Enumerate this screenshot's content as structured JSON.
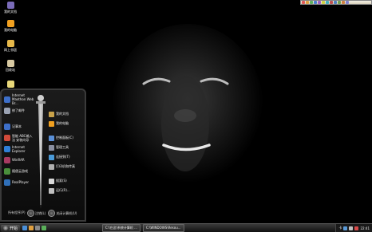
{
  "desktop_icons": [
    {
      "label": "我的文档",
      "color": "#7a6bb8"
    },
    {
      "label": "我的电脑",
      "color": "#f0a020"
    },
    {
      "label": "网上邻居",
      "color": "#e6b84a"
    },
    {
      "label": "回收站",
      "color": "#d8c9a2"
    },
    {
      "label": "",
      "color": "#e8d77a"
    }
  ],
  "start_menu": {
    "left_items": [
      {
        "label": "Internet Maxthon Web Br...",
        "color": "#3d6fc9"
      },
      {
        "label": "修了邮件",
        "color": "#9aa2b2"
      },
      {
        "label": "记事本",
        "color": "#3d6fc9"
      },
      {
        "label": "智能 ABC输入法 安装向导",
        "color": "#d04a3a"
      },
      {
        "label": "Internet Explorer",
        "color": "#2f7fd8"
      },
      {
        "label": "WinRAR",
        "color": "#a83a62"
      },
      {
        "label": "随便云游戏",
        "color": "#4a8f3c"
      },
      {
        "label": "RealPlayer",
        "color": "#2f6fb8"
      }
    ],
    "right_items": [
      {
        "label": "我的文档",
        "color": "#c9a24a"
      },
      {
        "label": "我的电脑",
        "color": "#f0a020"
      },
      {
        "label": "控制面板(C)",
        "color": "#5a8fd6"
      },
      {
        "label": "管理工具",
        "color": "#8a8fa0"
      },
      {
        "label": "连接到(T)",
        "color": "#4a9ad8"
      },
      {
        "label": "打印机和传真",
        "color": "#b0b0b0"
      },
      {
        "label": "搜索(S)",
        "color": "#d8d8d8"
      },
      {
        "label": "运行(R)...",
        "color": "#c0c0c0"
      }
    ],
    "all_programs": "所有程序(P)",
    "logoff": "注销(L)",
    "shutdown": "关闭计算机(U)"
  },
  "taskbar": {
    "start": "开始",
    "buttons": [
      "C:\\在这\\系统计算机 ...",
      "C:\\WINDOWS\\Resou..."
    ],
    "tray_time": "22:41",
    "tray_text": "卡"
  },
  "colors": {
    "taskbar": "#1a1a1a",
    "accent": "#3a3a3a"
  }
}
